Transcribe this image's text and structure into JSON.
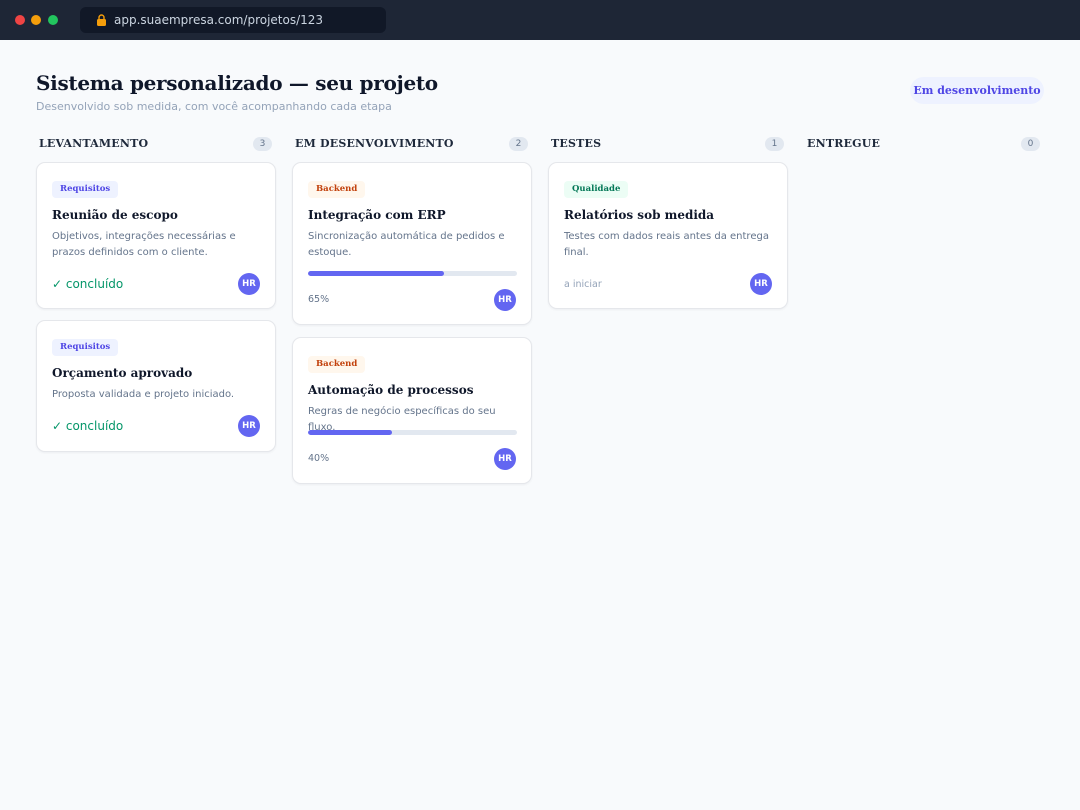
{
  "browser": {
    "url": "app.suaempresa.com/projetos/123"
  },
  "header": {
    "title": "Sistema personalizado — seu projeto",
    "subtitle": "Desenvolvido sob medida, com você acompanhando cada etapa",
    "status": "Em desenvolvimento"
  },
  "columns": [
    {
      "title": "LEVANTAMENTO",
      "count": "3",
      "cards": [
        {
          "tag": "Requisitos",
          "title": "Reunião de escopo",
          "description": "Objetivos, integrações necessárias e prazos definidos com o cliente.",
          "status": "✓ concluído",
          "assignee": "HR"
        },
        {
          "tag": "Requisitos",
          "title": "Orçamento aprovado",
          "description": "Proposta validada e projeto iniciado.",
          "status": "✓ concluído",
          "assignee": "HR"
        }
      ]
    },
    {
      "title": "EM DESENVOLVIMENTO",
      "count": "2",
      "cards": [
        {
          "tag": "Backend",
          "title": "Integração com ERP",
          "description": "Sincronização automática de pedidos e estoque.",
          "progress": 65,
          "progress_label": "65%",
          "assignee": "HR"
        },
        {
          "tag": "Backend",
          "title": "Automação de processos",
          "description": "Regras de negócio específicas do seu fluxo.",
          "progress": 40,
          "progress_label": "40%",
          "assignee": "HR"
        }
      ]
    },
    {
      "title": "TESTES",
      "count": "1",
      "cards": [
        {
          "tag": "Qualidade",
          "title": "Relatórios sob medida",
          "description": "Testes com dados reais antes da entrega final.",
          "status": "a iniciar",
          "assignee": "HR"
        }
      ]
    },
    {
      "title": "ENTREGUE",
      "count": "0",
      "cards": []
    }
  ],
  "colors": {
    "accent": "#6366f1",
    "success": "#059669",
    "chrome": "#1e2636"
  }
}
